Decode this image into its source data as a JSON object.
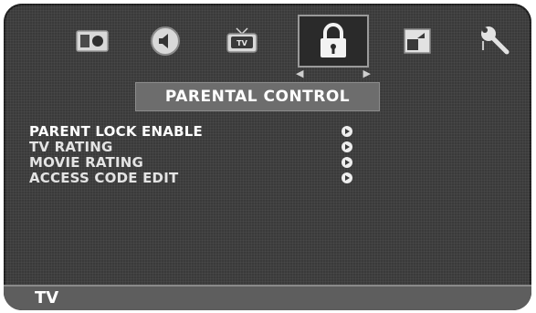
{
  "header": {
    "tabs": [
      {
        "icon": "picture-icon"
      },
      {
        "icon": "sound-icon"
      },
      {
        "icon": "tv-icon",
        "label": "TV"
      },
      {
        "icon": "lock-icon",
        "selected": true
      },
      {
        "icon": "screen-icon"
      },
      {
        "icon": "setup-icon"
      }
    ]
  },
  "menu": {
    "title": "PARENTAL CONTROL",
    "items": [
      {
        "label": "PARENT LOCK ENABLE"
      },
      {
        "label": "TV RATING"
      },
      {
        "label": "MOVIE RATING"
      },
      {
        "label": "ACCESS CODE EDIT"
      }
    ]
  },
  "footer": {
    "source": "TV"
  }
}
